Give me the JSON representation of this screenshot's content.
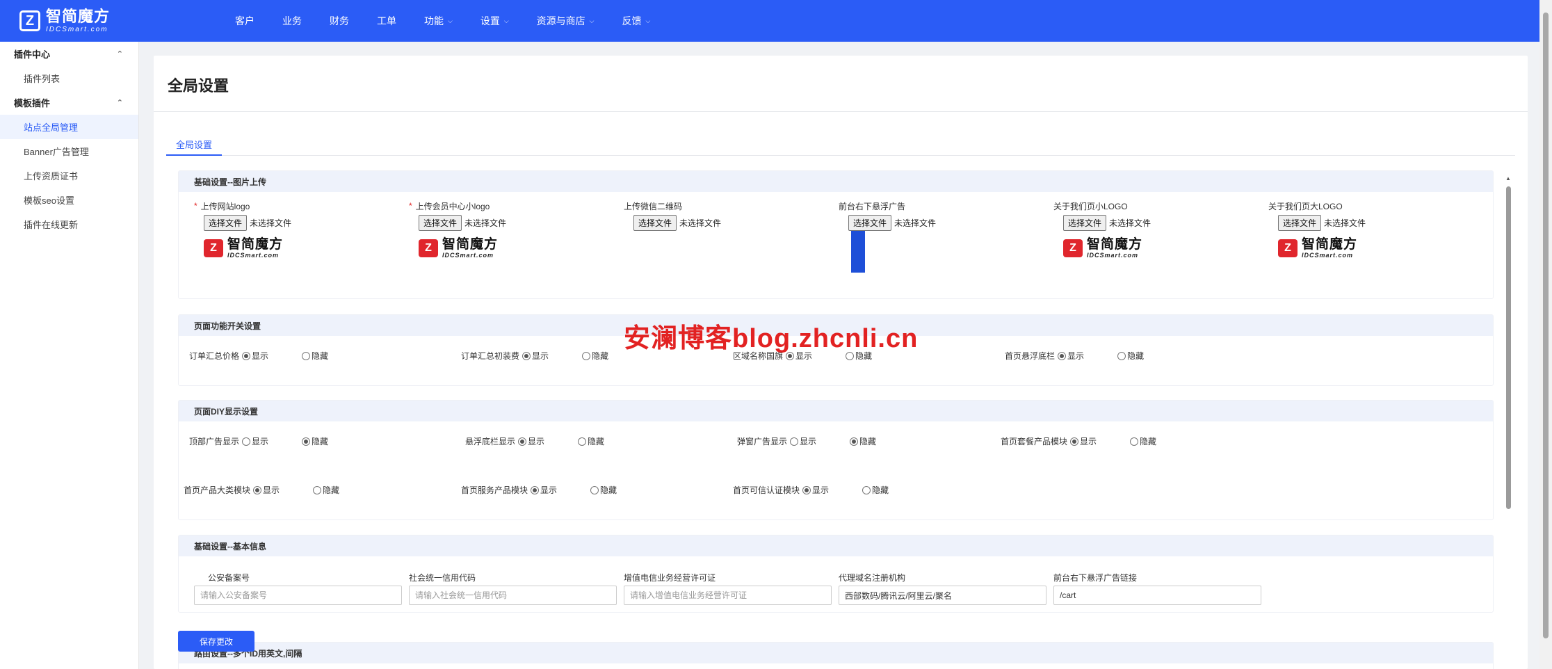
{
  "brand": {
    "name_cn": "智简魔方",
    "name_en": "IDCSmart.com"
  },
  "nav": [
    {
      "label": "客户",
      "has_dropdown": false
    },
    {
      "label": "业务",
      "has_dropdown": false
    },
    {
      "label": "财务",
      "has_dropdown": false
    },
    {
      "label": "工单",
      "has_dropdown": false
    },
    {
      "label": "功能",
      "has_dropdown": true
    },
    {
      "label": "设置",
      "has_dropdown": true
    },
    {
      "label": "资源与商店",
      "has_dropdown": true
    },
    {
      "label": "反馈",
      "has_dropdown": true
    }
  ],
  "sidebar": {
    "groups": [
      {
        "label": "插件中心",
        "items": [
          "插件列表"
        ]
      },
      {
        "label": "模板插件",
        "items": [
          "站点全局管理",
          "Banner广告管理",
          "上传资质证书",
          "模板seo设置",
          "插件在线更新"
        ]
      }
    ],
    "active_item": "站点全局管理"
  },
  "page": {
    "title": "全局设置",
    "tab": "全局设置"
  },
  "upload_section": {
    "title": "基础设置--图片上传",
    "choose_file_label": "选择文件",
    "no_file_label": "未选择文件",
    "fields": [
      {
        "label": "上传网站logo",
        "required": true,
        "preview": "logo"
      },
      {
        "label": "上传会员中心小logo",
        "required": true,
        "preview": "logo"
      },
      {
        "label": "上传微信二维码",
        "required": false,
        "preview": "none"
      },
      {
        "label": "前台右下悬浮广告",
        "required": false,
        "preview": "ad"
      },
      {
        "label": "关于我们页小LOGO",
        "required": false,
        "preview": "logo"
      },
      {
        "label": "关于我们页大LOGO",
        "required": false,
        "preview": "logo"
      }
    ]
  },
  "switch_section": {
    "title": "页面功能开关设置",
    "show_label": "显示",
    "hide_label": "隐藏",
    "items": [
      {
        "label": "订单汇总价格",
        "value": "show"
      },
      {
        "label": "订单汇总初装费",
        "value": "show"
      },
      {
        "label": "区域名称国旗",
        "value": "show"
      },
      {
        "label": "首页悬浮底栏",
        "value": "show"
      }
    ]
  },
  "diy_section": {
    "title": "页面DIY显示设置",
    "show_label": "显示",
    "hide_label": "隐藏",
    "items": [
      {
        "label": "顶部广告显示",
        "value": "hide"
      },
      {
        "label": "悬浮底栏显示",
        "value": "show"
      },
      {
        "label": "弹窗广告显示",
        "value": "hide"
      },
      {
        "label": "首页套餐产品模块",
        "value": "show"
      },
      {
        "label": "首页产品大类模块",
        "value": "show"
      },
      {
        "label": "首页服务产品模块",
        "value": "show"
      },
      {
        "label": "首页可信认证模块",
        "value": "show"
      }
    ]
  },
  "info_section": {
    "title": "基础设置--基本信息",
    "fields": [
      {
        "label": "公安备案号",
        "value": "",
        "placeholder": "请输入公安备案号"
      },
      {
        "label": "社会统一信用代码",
        "value": "",
        "placeholder": "请输入社会统一信用代码"
      },
      {
        "label": "增值电信业务经营许可证",
        "value": "",
        "placeholder": "请输入增值电信业务经营许可证"
      },
      {
        "label": "代理域名注册机构",
        "value": "西部数码/腾讯云/阿里云/聚名",
        "placeholder": ""
      },
      {
        "label": "前台右下悬浮广告链接",
        "value": "/cart",
        "placeholder": ""
      }
    ]
  },
  "next_section_title": "路由设置--多个ID用英文,间隔",
  "save_button": "保存更改",
  "watermark": "安澜博客blog.zhcnli.cn",
  "colors": {
    "primary": "#2b5cf6",
    "required": "#e02020",
    "watermark": "#e22222"
  }
}
